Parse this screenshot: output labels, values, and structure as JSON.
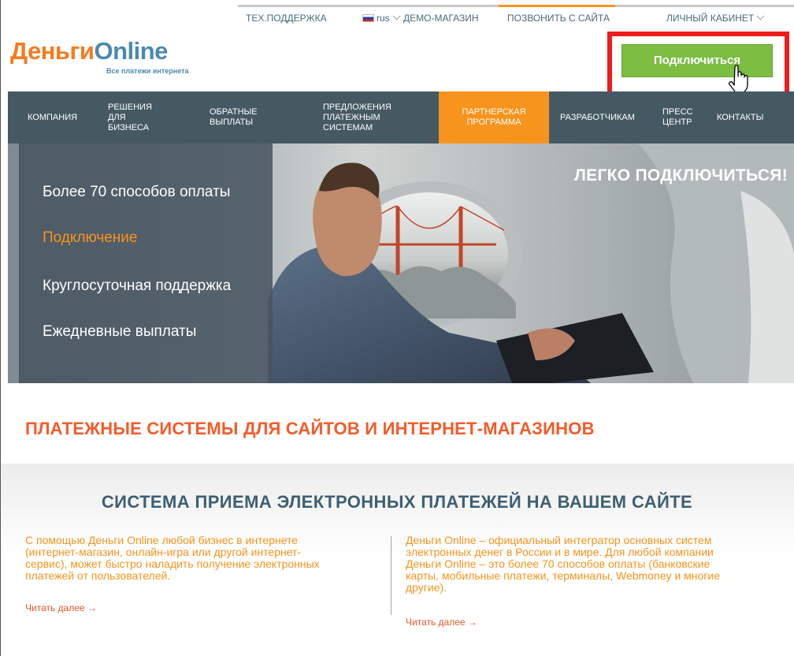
{
  "topbar": {
    "support": "ТЕХ.ПОДДЕРЖКА",
    "lang": "rus",
    "demo": "ДЕМО-МАГАЗИН",
    "call": "ПОЗВОНИТЬ С САЙТА",
    "account": "ЛИЧНЫЙ КАБИНЕТ"
  },
  "logo": {
    "part1": "Деньги",
    "part2": "Online",
    "tagline": "Все платежи интернета"
  },
  "connect_label": "Подключиться",
  "nav": {
    "items": [
      {
        "l1": "КОМПАНИЯ",
        "l2": "",
        "l3": ""
      },
      {
        "l1": "РЕШЕНИЯ",
        "l2": "ДЛЯ",
        "l3": "БИЗНЕСА"
      },
      {
        "l1": "ОБРАТНЫЕ",
        "l2": "ВЫПЛАТЫ",
        "l3": ""
      },
      {
        "l1": "ПРЕДЛОЖЕНИЯ",
        "l2": "ПЛАТЕЖНЫМ",
        "l3": "СИСТЕМАМ"
      },
      {
        "l1": "ПАРТНЕРСКАЯ",
        "l2": "ПРОГРАММА",
        "l3": ""
      },
      {
        "l1": "РАЗРАБОТЧИКАМ",
        "l2": "",
        "l3": ""
      },
      {
        "l1": "ПРЕСС",
        "l2": "ЦЕНТР",
        "l3": ""
      },
      {
        "l1": "КОНТАКТЫ",
        "l2": "",
        "l3": ""
      }
    ],
    "active_color": "#f7941d",
    "bg_color": "#455963"
  },
  "hero": {
    "items": [
      "Более 70 способов оплаты",
      "Подключение",
      "Круглосуточная поддержка",
      "Ежедневные выплаты"
    ],
    "active_index": 1,
    "title": "ЛЕГКО ПОДКЛЮЧИТЬСЯ!"
  },
  "section": {
    "title": "ПЛАТЕЖНЫЕ СИСТЕМЫ ДЛЯ САЙТОВ И ИНТЕРНЕТ-МАГАЗИНОВ",
    "subtitle": "СИСТЕМА ПРИЕМА ЭЛЕКТРОННЫХ ПЛАТЕЖЕЙ НА ВАШЕМ САЙТЕ"
  },
  "columns": {
    "left": {
      "lines": [
        "С помощью Деньги Online любой бизнес в интернете",
        "(интернет-магазин, онлайн-игра или другой интернет-",
        "сервис), может быстро наладить получение электронных",
        "платежей от пользователей."
      ],
      "more": "Читать далее →"
    },
    "right": {
      "lines": [
        "Деньги Online – официальный интегратор основных систем",
        "электронных денег в России и в мире. Для любой компании",
        "Деньги Online – это более 70 способов оплаты (банковские",
        "карты, мобильные платежи, терминалы, Webmoney и многие",
        "другие)."
      ],
      "more": "Читать далее →"
    }
  },
  "colors": {
    "accent_orange": "#f7941d",
    "heading_red": "#f45b2a",
    "button_green": "#7cbd42",
    "highlight_red": "#ee1c1c",
    "blue_heading": "#3d5f73"
  },
  "icons": [
    "flag-ru-icon",
    "chevron-down-icon",
    "hand-cursor-icon"
  ]
}
